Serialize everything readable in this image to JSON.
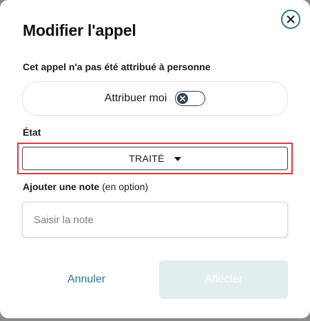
{
  "modal": {
    "title": "Modifier l'appel",
    "close_icon": "close-circle-icon"
  },
  "assignment": {
    "status_text": "Cet appel n'a pas été attribué à personne",
    "toggle_label": "Attribuer moi",
    "toggle_on": false
  },
  "state": {
    "label": "État",
    "selected_value": "TRAITÉ",
    "highlight_color": "#d9393f"
  },
  "note": {
    "label_bold": "Ajouter une note",
    "label_optional": " (en option)",
    "placeholder": "Saisir la note",
    "value": ""
  },
  "actions": {
    "cancel_label": "Annuler",
    "submit_label": "Affecter",
    "submit_enabled": false
  },
  "colors": {
    "accent": "#2b7a8a",
    "disabled_button": "#e3eef1"
  }
}
